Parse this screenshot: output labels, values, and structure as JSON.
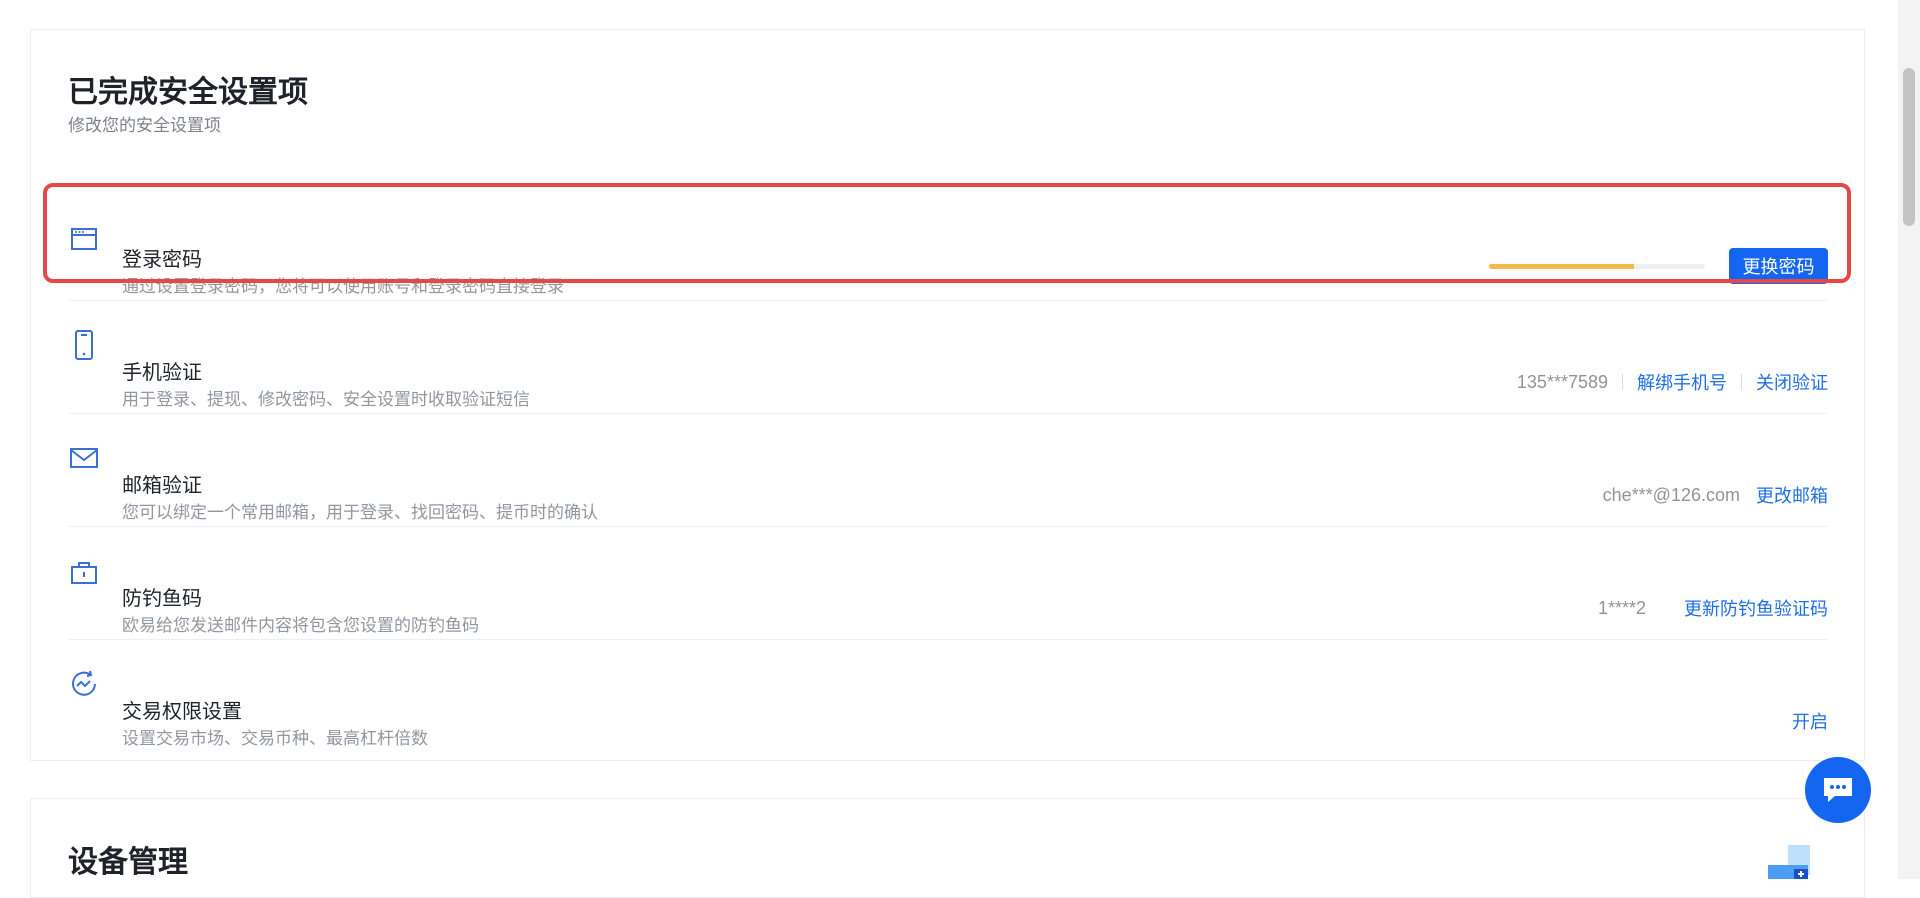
{
  "security": {
    "title": "已完成安全设置项",
    "subtitle": "修改您的安全设置项",
    "items": [
      {
        "name": "登录密码",
        "desc": "通过设置登录密码，您将可以使用账号和登录密码直接登录",
        "strength_fraction": 0.67,
        "action": "更换密码",
        "icon": "browser-window-icon"
      },
      {
        "name": "手机验证",
        "desc": "用于登录、提现、修改密码、安全设置时收取验证短信",
        "value": "135***7589",
        "actions": [
          "解绑手机号",
          "关闭验证"
        ],
        "icon": "mobile-phone-icon"
      },
      {
        "name": "邮箱验证",
        "desc": "您可以绑定一个常用邮箱，用于登录、找回密码、提币时的确认",
        "value": "che***@126.com",
        "actions": [
          "更改邮箱"
        ],
        "icon": "envelope-icon"
      },
      {
        "name": "防钓鱼码",
        "desc": "欧易给您发送邮件内容将包含您设置的防钓鱼码",
        "value": "1****2",
        "actions": [
          "更新防钓鱼验证码"
        ],
        "icon": "anti-phishing-lock-icon"
      },
      {
        "name": "交易权限设置",
        "desc": "设置交易市场、交易币种、最高杠杆倍数",
        "actions": [
          "开启"
        ],
        "icon": "trade-permission-icon"
      }
    ]
  },
  "devices": {
    "title": "设备管理"
  },
  "colors": {
    "accent": "#1466f1",
    "link": "#1f6fe5",
    "highlight_border": "#e84845",
    "strength_bar": "#f5b94b"
  }
}
